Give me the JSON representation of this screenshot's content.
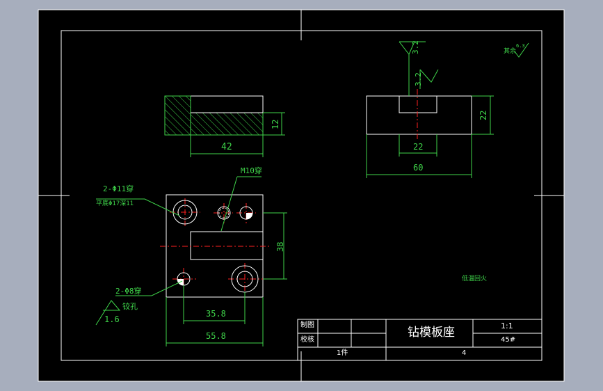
{
  "drawing": {
    "colors": {
      "background": "#a7aebd",
      "paper": "#000000",
      "line": "#ffffff",
      "dimension": "#3fd44a",
      "center_line": "#ff2020"
    },
    "top_roughness": "3.2",
    "roughness_note": "其余",
    "roughness_note_value": "6.3",
    "front_view": {
      "dim_length": "42",
      "dim_height": "12"
    },
    "side_view": {
      "roughness": "3.2",
      "dim_slot": "22",
      "dim_height": "22",
      "dim_width": "60"
    },
    "plan_view": {
      "note_thread": "M10穿",
      "note_holes_a": "2-Φ11穿",
      "note_holes_b": "平底Φ17深11",
      "note_pins_a": "2-Φ8穿",
      "note_pins_b": "铰孔",
      "roughness_pins": "1.6",
      "dim_height": "38",
      "dim_inner": "35.8",
      "dim_outer": "55.8"
    },
    "treatment_note": "低温回火",
    "title_block": {
      "row1_label": "制图",
      "row2_label": "校核",
      "part_name": "钻模板座",
      "scale": "1:1",
      "material": "45#",
      "quantity": "1件",
      "drawing_no": "4"
    }
  }
}
